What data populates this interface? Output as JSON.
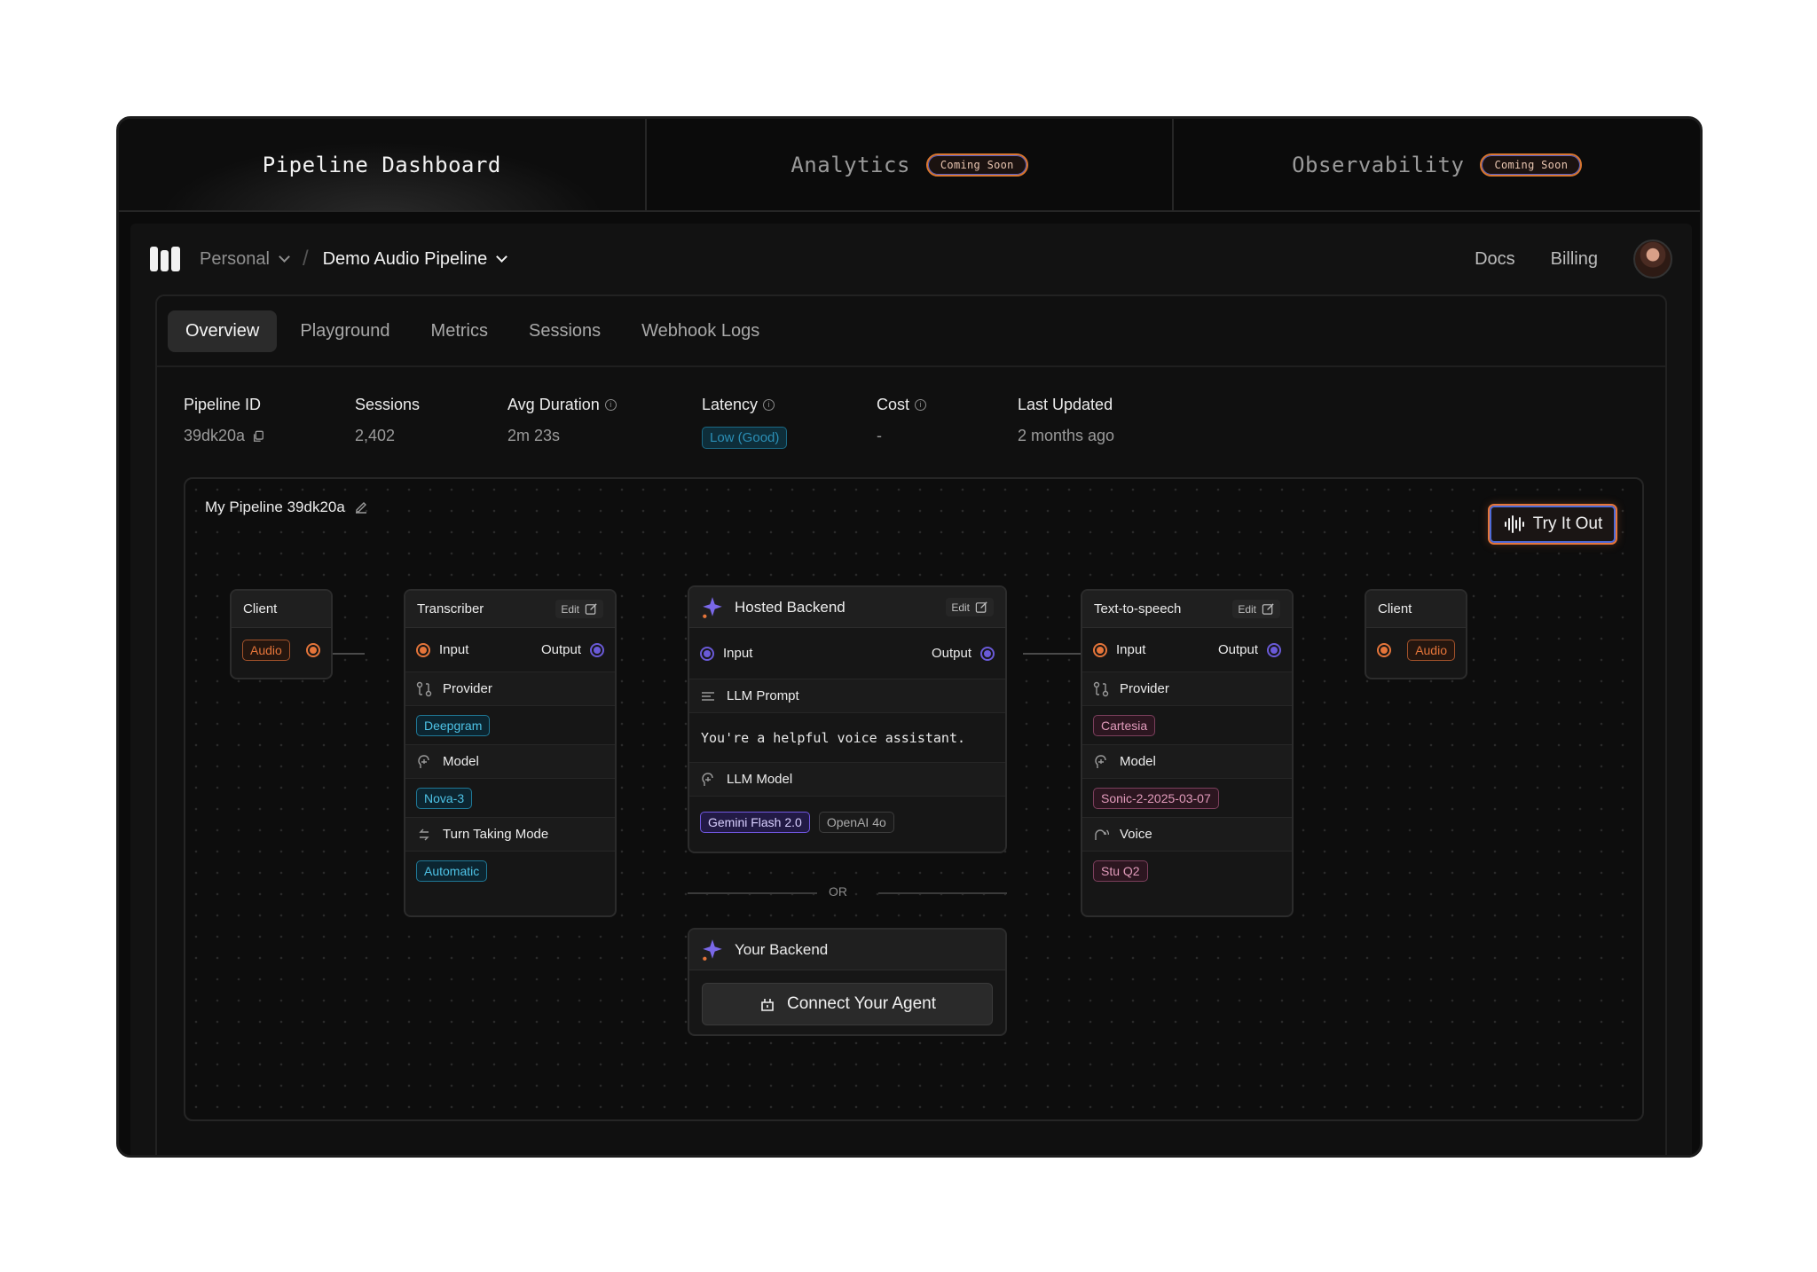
{
  "top_tabs": [
    {
      "label": "Pipeline Dashboard",
      "badge": ""
    },
    {
      "label": "Analytics",
      "badge": "Coming Soon"
    },
    {
      "label": "Observability",
      "badge": "Coming Soon"
    }
  ],
  "header": {
    "workspace": "Personal",
    "separator": "/",
    "project": "Demo Audio Pipeline",
    "links": [
      "Docs",
      "Billing"
    ]
  },
  "tabs": [
    "Overview",
    "Playground",
    "Metrics",
    "Sessions",
    "Webhook Logs"
  ],
  "stats": [
    {
      "label": "Pipeline ID",
      "value": "39dk20a"
    },
    {
      "label": "Sessions",
      "value": "2,402"
    },
    {
      "label": "Avg Duration",
      "value": "2m 23s"
    },
    {
      "label": "Latency",
      "value": "Low (Good)"
    },
    {
      "label": "Cost",
      "value": "-"
    },
    {
      "label": "Last Updated",
      "value": "2 months ago"
    }
  ],
  "canvas": {
    "title": "My Pipeline 39dk20a",
    "try_button": "Try It Out"
  },
  "nodes": {
    "client_in": {
      "title": "Client",
      "tag": "Audio"
    },
    "transcriber": {
      "title": "Transcriber",
      "edit": "Edit",
      "input": "Input",
      "output": "Output",
      "provider_label": "Provider",
      "provider": "Deepgram",
      "model_label": "Model",
      "model": "Nova-3",
      "turn_label": "Turn Taking Mode",
      "turn": "Automatic"
    },
    "hosted": {
      "title": "Hosted Backend",
      "edit": "Edit",
      "input": "Input",
      "output": "Output",
      "prompt_label": "LLM Prompt",
      "prompt": "You're a helpful voice assistant.",
      "model_label": "LLM Model",
      "models": [
        "Gemini Flash 2.0",
        "OpenAI 4o"
      ]
    },
    "or_text": "OR",
    "your_backend": {
      "title": "Your Backend",
      "button": "Connect Your Agent"
    },
    "tts": {
      "title": "Text-to-speech",
      "edit": "Edit",
      "input": "Input",
      "output": "Output",
      "provider_label": "Provider",
      "provider": "Cartesia",
      "model_label": "Model",
      "model": "Sonic-2-2025-03-07",
      "voice_label": "Voice",
      "voice": "Stu Q2"
    },
    "client_out": {
      "title": "Client",
      "tag": "Audio"
    }
  },
  "colors": {
    "accent_orange": "#e5753a",
    "accent_purple": "#6a5ad8",
    "accent_cyan": "#4ec3e6"
  }
}
